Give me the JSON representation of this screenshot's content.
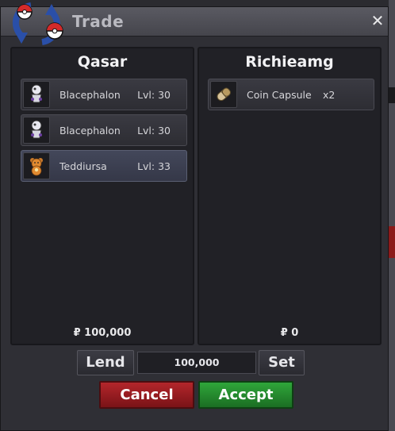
{
  "window": {
    "title": "Trade",
    "close_glyph": "✕"
  },
  "left_trader": {
    "name": "Qasar",
    "money": "₽ 100,000",
    "items": [
      {
        "name": "Blacephalon",
        "level": "Lvl: 30",
        "icon": "blacephalon-icon"
      },
      {
        "name": "Blacephalon",
        "level": "Lvl: 30",
        "icon": "blacephalon-icon"
      },
      {
        "name": "Teddiursa",
        "level": "Lvl: 33",
        "icon": "teddiursa-icon"
      }
    ]
  },
  "right_trader": {
    "name": "Richieamg",
    "money": "₽ 0",
    "items": [
      {
        "name": "Coin Capsule",
        "quantity": "x2",
        "icon": "coin-capsule-icon"
      }
    ]
  },
  "controls": {
    "lend_label": "Lend",
    "amount_value": "100,000",
    "set_label": "Set",
    "cancel_label": "Cancel",
    "accept_label": "Accept"
  },
  "colors": {
    "cancel": "#b3262b",
    "accept": "#2fa63a",
    "panel_bg": "#212126"
  }
}
